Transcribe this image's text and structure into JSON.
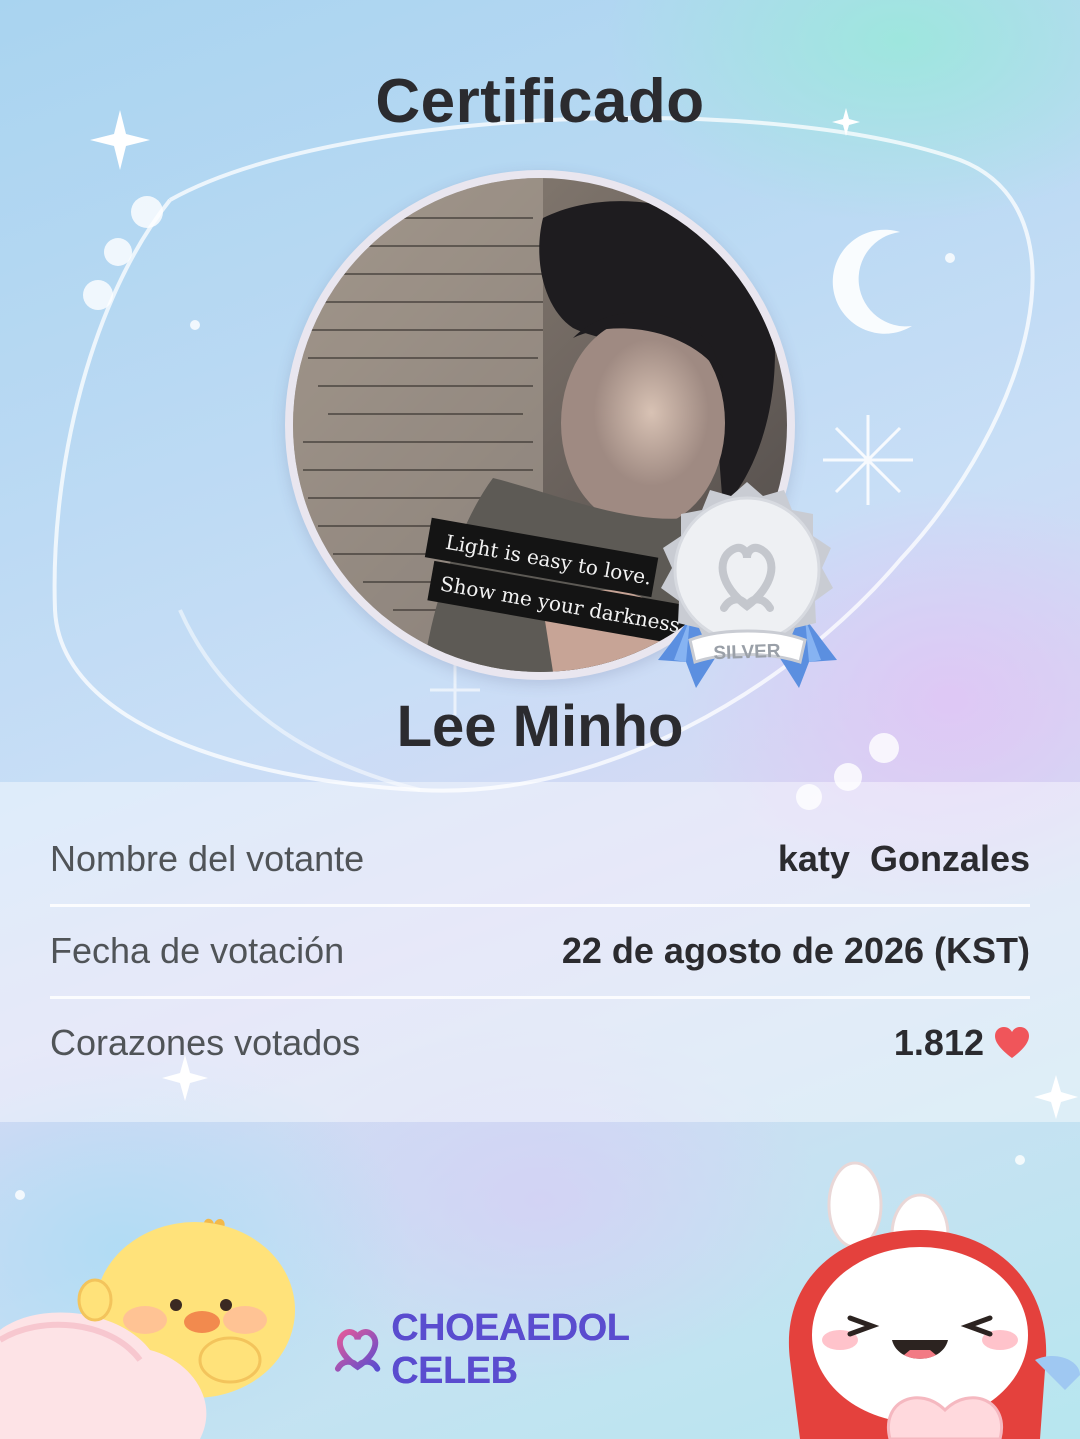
{
  "title": "Certificado",
  "celebrity_name": "Lee Minho",
  "photo_caption": {
    "line1": "Light is easy to love.",
    "line2": "Show me your darkness."
  },
  "badge": {
    "tier": "SILVER",
    "icon": "heart-ribbon-icon"
  },
  "details": {
    "voter": {
      "label": "Nombre del votante",
      "value": "katy  Gonzales"
    },
    "date": {
      "label": "Fecha de votación",
      "value": "22 de agosto de 2026 (KST)"
    },
    "hearts": {
      "label": "Corazones votados",
      "value": "1.812",
      "icon": "heart-icon"
    }
  },
  "brand": {
    "name": "CHOEAEDOL CELEB",
    "logo": "choeaedol-heart-logo"
  },
  "colors": {
    "heart": "#f0555a",
    "brand": "#5a4ccf",
    "badge_ribbon": "#5b8fe0",
    "text_dark": "#2b2b2f"
  }
}
